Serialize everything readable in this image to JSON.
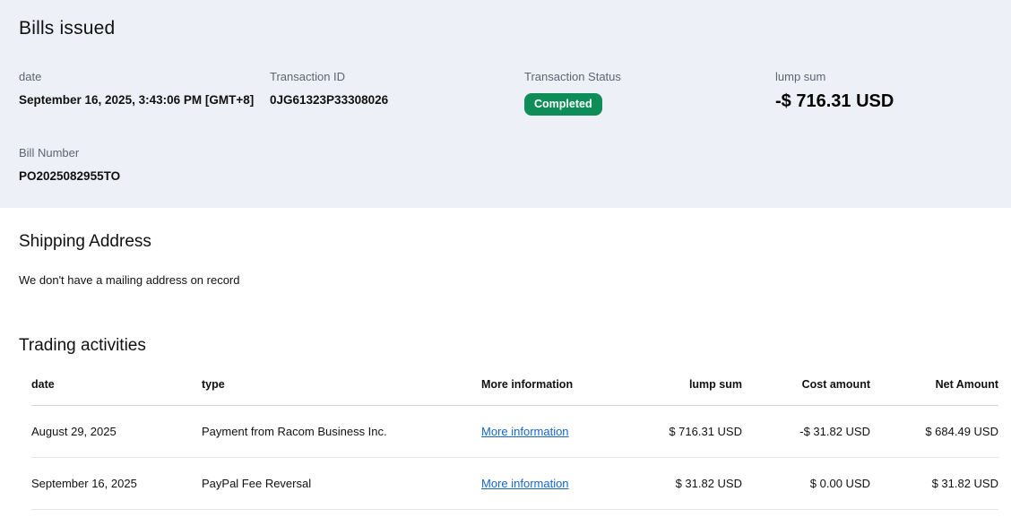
{
  "header": {
    "title": "Bills issued",
    "fields": {
      "date": {
        "label": "date",
        "value": "September 16, 2025, 3:43:06 PM [GMT+8]"
      },
      "transaction_id": {
        "label": "Transaction ID",
        "value": "0JG61323P33308026"
      },
      "transaction_status": {
        "label": "Transaction Status",
        "badge": "Completed"
      },
      "lump_sum": {
        "label": "lump sum",
        "value": "-$ 716.31 USD"
      },
      "bill_number": {
        "label": "Bill Number",
        "value": "PO2025082955TO"
      }
    }
  },
  "shipping": {
    "heading": "Shipping Address",
    "message": "We don't have a mailing address on record"
  },
  "trading": {
    "heading": "Trading activities",
    "columns": [
      "date",
      "type",
      "More information",
      "lump sum",
      "Cost amount",
      "Net Amount"
    ],
    "rows": [
      {
        "date": "August 29, 2025",
        "type": "Payment from Racom Business Inc.",
        "more_info": "More information",
        "lump_sum": "$ 716.31 USD",
        "cost_amount": "-$ 31.82 USD",
        "net_amount": "$ 684.49 USD"
      },
      {
        "date": "September 16, 2025",
        "type": "PayPal Fee Reversal",
        "more_info": "More information",
        "lump_sum": "$ 31.82 USD",
        "cost_amount": "$ 0.00 USD",
        "net_amount": "$ 31.82 USD"
      }
    ]
  },
  "colors": {
    "band_bg": "#eef0f8",
    "badge_green": "#0e8d58",
    "link_blue": "#1566c8",
    "label_gray": "#5e6570"
  }
}
